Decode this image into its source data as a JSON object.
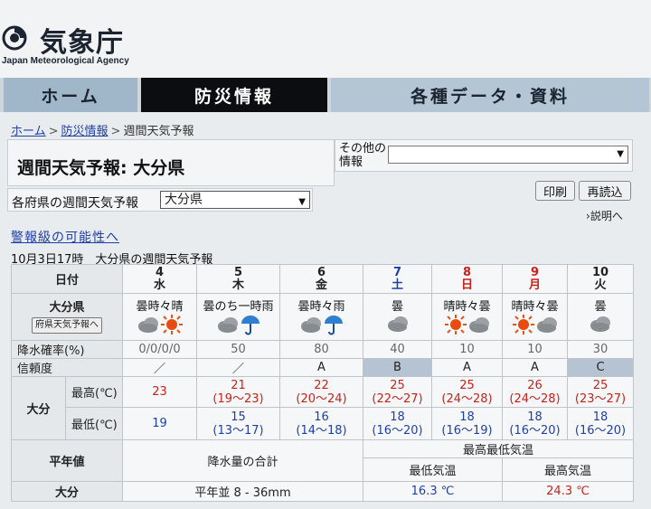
{
  "header": {
    "logo_text": "気象庁",
    "logo_sub": "Japan Meteorological Agency"
  },
  "nav": {
    "home": "ホーム",
    "bosai": "防災情報",
    "data": "各種データ・資料"
  },
  "breadcrumb": {
    "home": "ホーム",
    "bosai": "防災情報",
    "current": "週間天気予報",
    "sep": ">"
  },
  "page_title": "週間天気予報: 大分県",
  "other_info": {
    "label": "その他の情報",
    "value": ""
  },
  "pref_select": {
    "label": "各府県の週間天気予報",
    "value": "大分県"
  },
  "buttons": {
    "print": "印刷",
    "reload": "再読込"
  },
  "help_link": "説明へ",
  "keihou_link": "警報級の可能性へ",
  "issued": "10月3日17時　大分県の週間天気予報",
  "table": {
    "date_label": "日付",
    "pref_name": "大分県",
    "pref_button": "府県天気予報へ",
    "pop_label": "降水確率(%)",
    "reliability_label": "信頼度",
    "area": "大分",
    "max_label": "最高(℃)",
    "min_label": "最低(℃)",
    "days": [
      {
        "date": "4",
        "dow": "水",
        "type": "weekday",
        "weather": "曇時々晴",
        "icons": [
          "cloud",
          "sun"
        ],
        "pop": "0/0/0/0",
        "rel": "／",
        "max": "23",
        "max_range": "",
        "min": "19",
        "min_range": ""
      },
      {
        "date": "5",
        "dow": "木",
        "type": "weekday",
        "weather": "曇のち一時雨",
        "icons": [
          "cloud",
          "umbrella"
        ],
        "pop": "50",
        "rel": "／",
        "max": "21",
        "max_range": "(19〜23)",
        "min": "15",
        "min_range": "(13〜17)"
      },
      {
        "date": "6",
        "dow": "金",
        "type": "weekday",
        "weather": "曇時々雨",
        "icons": [
          "cloud",
          "umbrella"
        ],
        "pop": "80",
        "rel": "A",
        "max": "22",
        "max_range": "(20〜24)",
        "min": "16",
        "min_range": "(14〜18)"
      },
      {
        "date": "7",
        "dow": "土",
        "type": "sat",
        "weather": "曇",
        "icons": [
          "cloud"
        ],
        "pop": "40",
        "rel": "B",
        "max": "25",
        "max_range": "(22〜27)",
        "min": "18",
        "min_range": "(16〜20)"
      },
      {
        "date": "8",
        "dow": "日",
        "type": "sun",
        "weather": "晴時々曇",
        "icons": [
          "sun",
          "cloud"
        ],
        "pop": "10",
        "rel": "A",
        "max": "25",
        "max_range": "(24〜28)",
        "min": "18",
        "min_range": "(16〜19)"
      },
      {
        "date": "9",
        "dow": "月",
        "type": "sun",
        "weather": "晴時々曇",
        "icons": [
          "sun",
          "cloud"
        ],
        "pop": "10",
        "rel": "A",
        "max": "26",
        "max_range": "(24〜28)",
        "min": "18",
        "min_range": "(16〜20)"
      },
      {
        "date": "10",
        "dow": "火",
        "type": "weekday",
        "weather": "曇",
        "icons": [
          "cloud"
        ],
        "pop": "30",
        "rel": "C",
        "max": "25",
        "max_range": "(23〜27)",
        "min": "18",
        "min_range": "(16〜20)"
      }
    ],
    "normal": {
      "label": "平年値",
      "minmax_header": "最高最低気温",
      "precip_header": "降水量の合計",
      "min_header": "最低気温",
      "max_header": "最高気温",
      "area": "大分",
      "precip_value": "平年並 8 - 36mm",
      "min_value": "16.3 ℃",
      "max_value": "24.3 ℃"
    }
  },
  "colors": {
    "accent_red": "#c8221b",
    "accent_blue": "#1f3fa8",
    "nav_active": "#0b0d10"
  }
}
